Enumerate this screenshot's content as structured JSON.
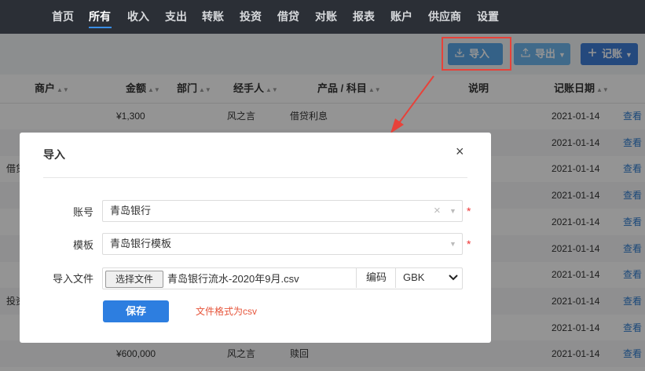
{
  "nav": {
    "items": [
      "首页",
      "所有",
      "收入",
      "支出",
      "转账",
      "投资",
      "借贷",
      "对账",
      "报表",
      "账户",
      "供应商",
      "设置"
    ],
    "active": "所有"
  },
  "toolbar": {
    "import_label": "导入",
    "export_label": "导出",
    "add_label": "记账"
  },
  "table": {
    "headers": {
      "merchant": "商户",
      "amount": "金额",
      "dept": "部门",
      "handler": "经手人",
      "product": "产品 / 科目",
      "note": "说明",
      "date": "记账日期"
    },
    "rows": [
      {
        "left": "",
        "amount": "¥1,300",
        "handler": "风之言",
        "product": "借贷利息",
        "date": "2021-01-14",
        "action": "查看"
      },
      {
        "left": "",
        "amount": "",
        "handler": "",
        "product": "",
        "date": "2021-01-14",
        "action": "查看"
      },
      {
        "left": "借贷",
        "amount": "",
        "handler": "",
        "product": "",
        "date": "2021-01-14",
        "action": "查看"
      },
      {
        "left": "",
        "amount": "",
        "handler": "",
        "product": "",
        "date": "2021-01-14",
        "action": "查看"
      },
      {
        "left": "",
        "amount": "",
        "handler": "",
        "product": "",
        "date": "2021-01-14",
        "action": "查看"
      },
      {
        "left": "",
        "amount": "",
        "handler": "",
        "product": "",
        "date": "2021-01-14",
        "action": "查看"
      },
      {
        "left": "",
        "amount": "",
        "handler": "",
        "product": "",
        "date": "2021-01-14",
        "action": "查看"
      },
      {
        "left": "投资",
        "amount": "",
        "handler": "",
        "product": "",
        "date": "2021-01-14",
        "action": "查看"
      },
      {
        "left": "",
        "amount": "",
        "handler": "",
        "product": "",
        "date": "2021-01-14",
        "action": "查看"
      },
      {
        "left": "",
        "amount": "¥600,000",
        "handler": "风之言",
        "product": "赎回",
        "date": "2021-01-14",
        "action": "查看"
      }
    ]
  },
  "modal": {
    "title": "导入",
    "account_label": "账号",
    "account_value": "青岛银行",
    "template_label": "模板",
    "template_value": "青岛银行模板",
    "file_label": "导入文件",
    "file_button": "选择文件",
    "file_name": "青岛银行流水-2020年9月.csv",
    "encoding_label": "编码",
    "encoding_value": "GBK",
    "save_label": "保存",
    "hint": "文件格式为csv",
    "required_mark": "*",
    "close_symbol": "×"
  },
  "colors": {
    "nav_bg": "#2b2f36",
    "primary": "#2d7ee0",
    "highlight": "#e7423a",
    "hint": "#e6543a",
    "link": "#2f7dd1"
  },
  "icons": {
    "import": "download-icon",
    "export": "upload-icon",
    "add": "plus-icon",
    "close": "close-icon"
  }
}
